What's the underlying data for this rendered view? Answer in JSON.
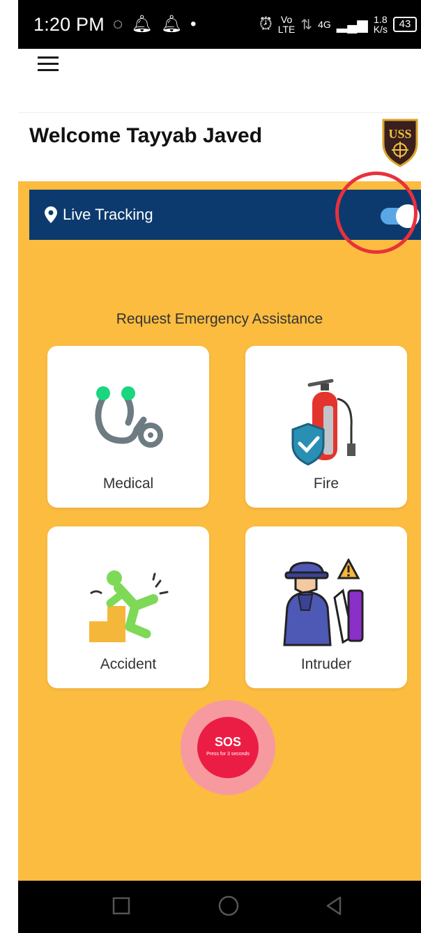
{
  "status_bar": {
    "time": "1:20 PM",
    "vo_lte_top": "Vo",
    "vo_lte_bottom": "LTE",
    "network": "4G",
    "speed_top": "1.8",
    "speed_bottom": "K/s",
    "battery": "43"
  },
  "header": {
    "welcome": "Welcome Tayyab Javed",
    "logo_text": "USS"
  },
  "tracking": {
    "label": "Live Tracking",
    "enabled": true
  },
  "emergency": {
    "title": "Request Emergency Assistance",
    "cards": [
      {
        "label": "Medical",
        "icon": "stethoscope-icon"
      },
      {
        "label": "Fire",
        "icon": "fire-extinguisher-icon"
      },
      {
        "label": "Accident",
        "icon": "falling-person-icon"
      },
      {
        "label": "Intruder",
        "icon": "intruder-icon"
      }
    ]
  },
  "sos": {
    "label": "SOS",
    "hint": "Press for 3 seconds"
  },
  "colors": {
    "background": "#fbbc40",
    "tracking_bar": "#0d3a6e",
    "sos": "#ec1d44",
    "highlight": "#e8313b"
  }
}
